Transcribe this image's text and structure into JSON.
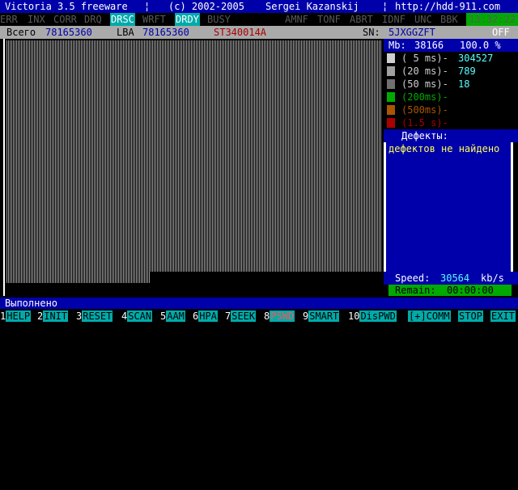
{
  "title": {
    "app": "Victoria 3.5 freeware",
    "copyright": "(c) 2002-2005",
    "author": "Sergei Kazanskij",
    "url": "http://hdd-911.com",
    "sep": "¦"
  },
  "flags": {
    "items": [
      "ERR",
      "INX",
      "CORR",
      "DRQ",
      "DRSC",
      "WRFT",
      "DRDY",
      "BUSY"
    ],
    "active": [
      "DRSC",
      "DRDY"
    ],
    "right_items": [
      "AMNF",
      "TONF",
      "ABRT",
      "IDNF",
      "UNC",
      "BBK"
    ],
    "clock": "13:32:22"
  },
  "info": {
    "total_label": "Всего",
    "total_value": "78165360",
    "lba_label": "LBA",
    "lba_value": "78165360",
    "model": "ST340014A",
    "sn_label": "SN:",
    "sn_value": "5JXGGZFT",
    "off": "OFF"
  },
  "panel": {
    "mb_label": "Mb:",
    "mb_value": "38166",
    "percent": "100.0 %",
    "stats": [
      {
        "label": "( 5 ms)-",
        "count": "304527",
        "color": "#d0d0d0"
      },
      {
        "label": "(20 ms)-",
        "count": "789",
        "color": "#a0a0a0"
      },
      {
        "label": "(50 ms)-",
        "count": "18",
        "color": "#707070"
      },
      {
        "label": "(200ms)-",
        "count": "",
        "color": "#00aa00"
      },
      {
        "label": "(500ms)-",
        "count": "",
        "color": "#aa5500"
      },
      {
        "label": "(1.5 s)-",
        "count": "",
        "color": "#aa0000"
      }
    ],
    "defects_title": "Дефекты:",
    "defects_text": "дефектов не найдено",
    "speed_label": "Speed:",
    "speed_value": "30564",
    "speed_unit": "kb/s",
    "remain_label": "Remain:",
    "remain_value": "00:00:00"
  },
  "status": "Выполнено",
  "fkeys": [
    {
      "n": "1",
      "t": "HELP"
    },
    {
      "n": "2",
      "t": "INIT"
    },
    {
      "n": "3",
      "t": "RESET"
    },
    {
      "n": "4",
      "t": "SCAN"
    },
    {
      "n": "5",
      "t": "AAM"
    },
    {
      "n": "6",
      "t": "HPA"
    },
    {
      "n": "7",
      "t": "SEEK"
    },
    {
      "n": "8",
      "t": "PSWD"
    },
    {
      "n": "9",
      "t": "SMART"
    },
    {
      "n": "10",
      "t": "DisPWD"
    },
    {
      "n": "",
      "t": "[+]COMM"
    },
    {
      "n": "",
      "t": "STOP"
    },
    {
      "n": "",
      "t": "EXIT"
    }
  ]
}
